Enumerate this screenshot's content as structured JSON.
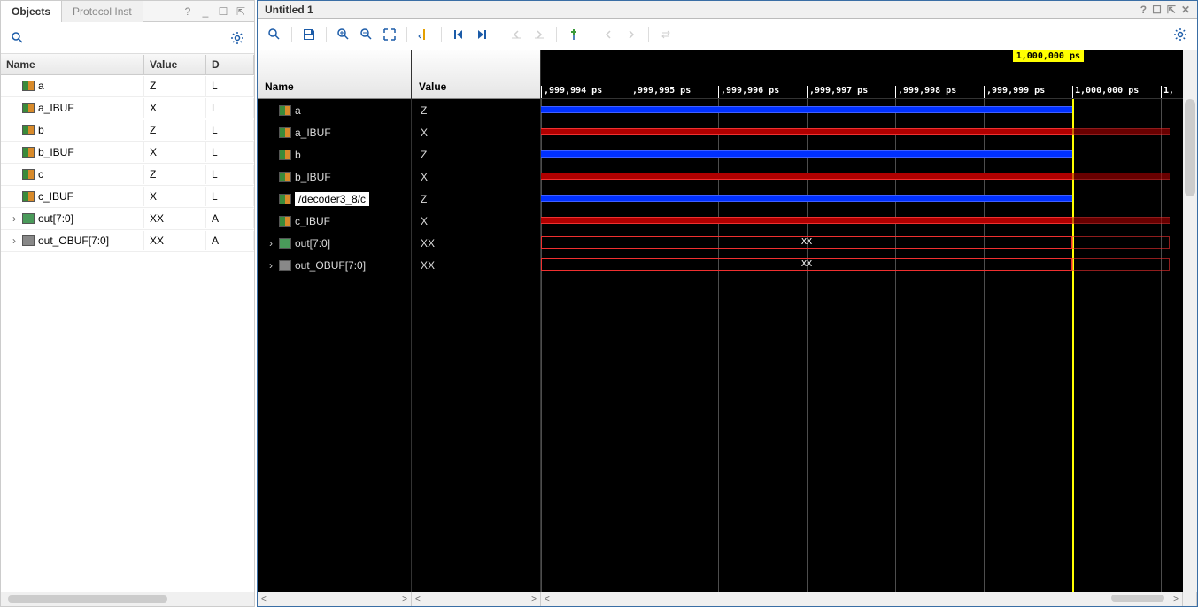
{
  "left": {
    "tab_objects": "Objects",
    "tab_protocol": "Protocol Inst",
    "header_name": "Name",
    "header_value": "Value",
    "header_d": "D",
    "signals": [
      {
        "name": "a",
        "value": "Z",
        "d": "L",
        "icon": "sig"
      },
      {
        "name": "a_IBUF",
        "value": "X",
        "d": "L",
        "icon": "sig"
      },
      {
        "name": "b",
        "value": "Z",
        "d": "L",
        "icon": "sig"
      },
      {
        "name": "b_IBUF",
        "value": "X",
        "d": "L",
        "icon": "sig"
      },
      {
        "name": "c",
        "value": "Z",
        "d": "L",
        "icon": "sig"
      },
      {
        "name": "c_IBUF",
        "value": "X",
        "d": "L",
        "icon": "sig"
      },
      {
        "name": "out[7:0]",
        "value": "XX",
        "d": "A",
        "icon": "bus",
        "exp": true
      },
      {
        "name": "out_OBUF[7:0]",
        "value": "XX",
        "d": "A",
        "icon": "bus2",
        "exp": true
      }
    ]
  },
  "right": {
    "title": "Untitled 1",
    "header_name": "Name",
    "header_value": "Value",
    "cursor_label": "1,000,000 ps",
    "signals": [
      {
        "name": "a",
        "value": "Z",
        "icon": "sig",
        "wave": "blue"
      },
      {
        "name": "a_IBUF",
        "value": "X",
        "icon": "sig",
        "wave": "red"
      },
      {
        "name": "b",
        "value": "Z",
        "icon": "sig",
        "wave": "blue"
      },
      {
        "name": "b_IBUF",
        "value": "X",
        "icon": "sig",
        "wave": "red"
      },
      {
        "name": "/decoder3_8/c",
        "value": "Z",
        "icon": "sig",
        "wave": "blue",
        "selected": true
      },
      {
        "name": "c_IBUF",
        "value": "X",
        "icon": "sig",
        "wave": "red"
      },
      {
        "name": "out[7:0]",
        "value": "XX",
        "icon": "bus",
        "wave": "bus",
        "exp": true,
        "dispname": "out[7:0]"
      },
      {
        "name": "out_OBUF[7:0]",
        "value": "XX",
        "icon": "bus2",
        "wave": "bus",
        "exp": true,
        "dispname": "out_OBUF[7:0]"
      }
    ],
    "ticks": [
      ",999,994 ps",
      ",999,995 ps",
      ",999,996 ps",
      ",999,997 ps",
      ",999,998 ps",
      ",999,999 ps",
      "1,000,000 ps",
      "1,"
    ],
    "bus_label": "XX"
  }
}
